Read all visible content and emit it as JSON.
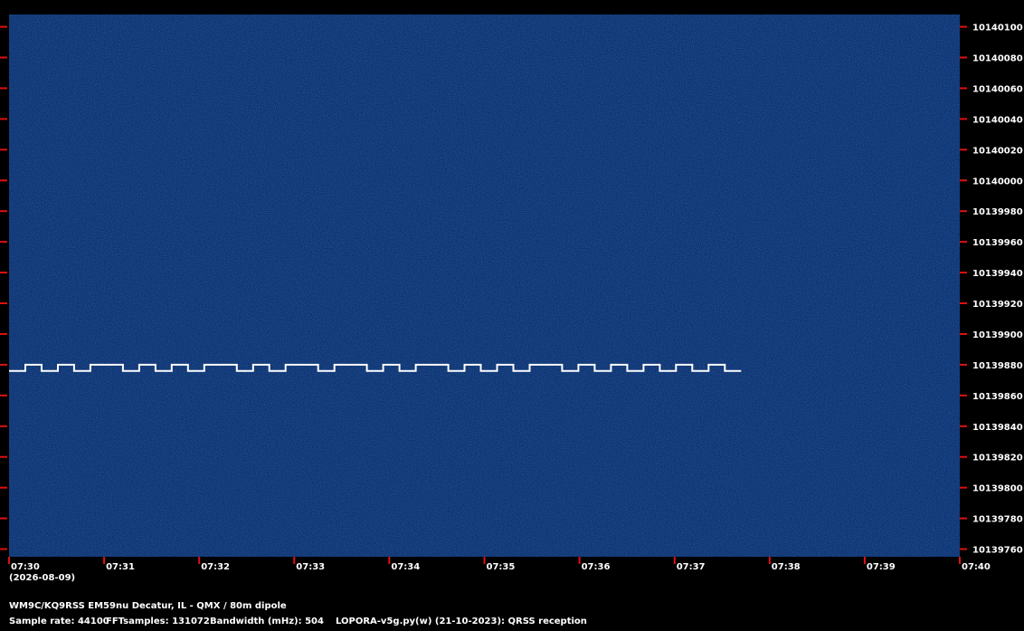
{
  "chart_data": {
    "type": "heatmap",
    "title": "",
    "xlabel": "",
    "ylabel": "",
    "x_ticks": [
      "07:30",
      "07:31",
      "07:32",
      "07:33",
      "07:34",
      "07:35",
      "07:36",
      "07:37",
      "07:38",
      "07:39",
      "07:40"
    ],
    "x_range": [
      "07:30",
      "07:40"
    ],
    "date_label": "(2026-08-09)",
    "y_ticks": [
      10140100,
      10140080,
      10140060,
      10140040,
      10140020,
      10140000,
      10139980,
      10139960,
      10139940,
      10139920,
      10139900,
      10139880,
      10139860,
      10139840,
      10139820,
      10139800,
      10139780,
      10139760
    ],
    "y_range": [
      10139755,
      10140108
    ],
    "signal": {
      "description_color": "#ffffff",
      "start_time": "07:30",
      "end_time": "07:37.7",
      "low_freq": 10139876,
      "high_freq": 10139880,
      "keying": [
        0,
        1,
        0,
        1,
        0,
        1,
        1,
        0,
        1,
        0,
        1,
        0,
        1,
        1,
        0,
        1,
        0,
        1,
        1,
        0,
        1,
        1,
        0,
        1,
        0,
        1,
        1,
        0,
        1,
        0,
        1,
        0,
        1,
        1,
        0,
        1,
        0,
        1,
        0,
        1,
        0,
        1,
        0,
        1,
        0
      ]
    },
    "colors": {
      "background_noise": "#0d2a66",
      "signal": "#ffffff",
      "tick_marks": "#e01010",
      "axis_text": "#ffffff"
    }
  },
  "footer": {
    "station_line": "WM9C/KQ9RSS EM59nu Decatur, IL - QMX / 80m dipole",
    "sample_rate": "Sample rate: 44100",
    "fft_samples": "FFTsamples: 131072",
    "bandwidth": "Bandwidth (mHz): 504",
    "software": "LOPORA-v5g.py(w) (21-10-2023): QRSS reception"
  }
}
